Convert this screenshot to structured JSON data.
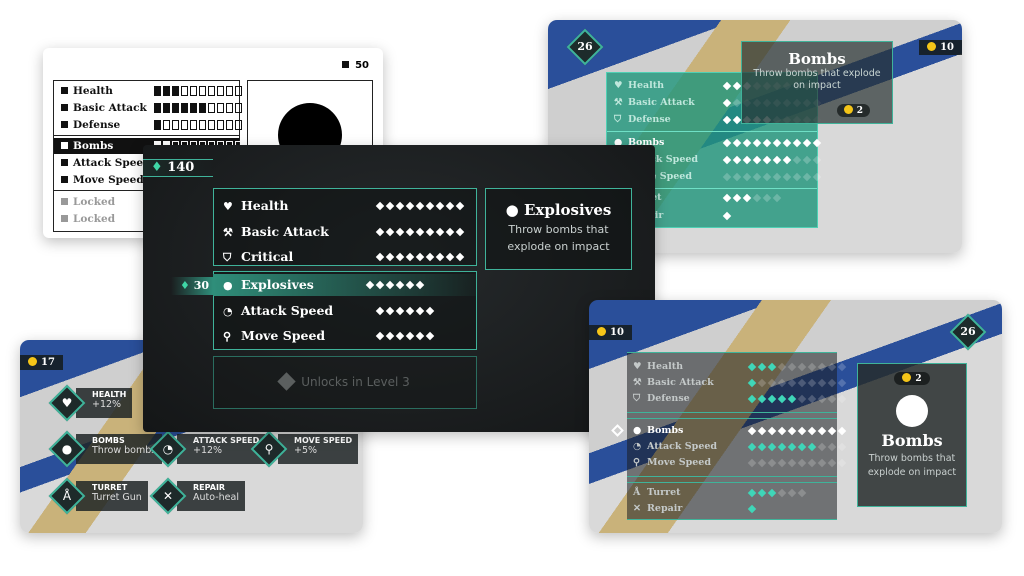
{
  "colors": {
    "accent": "#3fb39a",
    "pip_active": "#3fd6b8",
    "coin": "#f5c518",
    "gem": "#3fd6a6"
  },
  "wireframe": {
    "coins": "50",
    "stats": [
      {
        "label": "Health",
        "filled": 3,
        "total": 10
      },
      {
        "label": "Basic Attack",
        "filled": 6,
        "total": 10
      },
      {
        "label": "Defense",
        "filled": 1,
        "total": 10
      }
    ],
    "abilities": [
      {
        "label": "Bombs",
        "filled": 2,
        "total": 10,
        "selected": true
      },
      {
        "label": "Attack Speed"
      },
      {
        "label": "Move Speed"
      }
    ],
    "locked": [
      "Locked",
      "Locked"
    ]
  },
  "center": {
    "gems": "140",
    "stats": [
      {
        "label": "Health",
        "icon": "heart-icon",
        "filled": 9,
        "total": 9
      },
      {
        "label": "Basic Attack",
        "icon": "wrench-icon",
        "filled": 9,
        "total": 9
      },
      {
        "label": "Critical",
        "icon": "shield-icon",
        "filled": 9,
        "total": 9
      }
    ],
    "abilities": [
      {
        "label": "Explosives",
        "icon": "bomb-icon",
        "filled": 6,
        "total": 6
      },
      {
        "label": "Attack Speed",
        "icon": "speedometer-icon",
        "filled": 6,
        "total": 6
      },
      {
        "label": "Move Speed",
        "icon": "running-icon",
        "filled": 6,
        "total": 6
      }
    ],
    "ability_cost": "30",
    "locked_text": "Unlocks in Level 3",
    "detail": {
      "title": "Explosives",
      "desc": "Throw bombs that explode on impact"
    }
  },
  "top_right": {
    "level": "26",
    "coins": "10",
    "rows": [
      {
        "label": "Health",
        "icon": "heart-icon",
        "filled": 2,
        "half": 1,
        "total": 10
      },
      {
        "label": "Basic Attack",
        "icon": "wrench-icon",
        "filled": 1,
        "half": 0,
        "total": 10
      },
      {
        "label": "Defense",
        "icon": "shield-icon",
        "filled": 2,
        "half": 3,
        "total": 10
      },
      {
        "label": "Bombs",
        "icon": "bomb-icon",
        "filled": 10,
        "half": 0,
        "total": 10
      },
      {
        "label": "Attack Speed",
        "icon": "speedometer-icon",
        "filled": 7,
        "half": 0,
        "total": 10
      },
      {
        "label": "Move Speed",
        "icon": "running-icon",
        "filled": 0,
        "half": 0,
        "total": 10
      },
      {
        "label": "Turret",
        "icon": "turret-icon",
        "filled": 3,
        "half": 0,
        "total": 6
      },
      {
        "label": "Repair",
        "icon": "repair-icon",
        "filled": 1,
        "half": 0,
        "total": 1
      }
    ],
    "tooltip": {
      "title": "Bombs",
      "desc": "Throw bombs that explode on impact",
      "cost": "2"
    }
  },
  "bottom_right": {
    "level": "26",
    "coins": "10",
    "rows": [
      {
        "label": "Health",
        "icon": "heart-icon",
        "filled": 3,
        "total": 10
      },
      {
        "label": "Basic Attack",
        "icon": "wrench-icon",
        "filled": 1,
        "total": 10
      },
      {
        "label": "Defense",
        "icon": "shield-icon",
        "filled": 5,
        "total": 10
      },
      {
        "label": "Bombs",
        "icon": "bomb-icon",
        "filled": 10,
        "total": 10,
        "selected": true
      },
      {
        "label": "Attack Speed",
        "icon": "speedometer-icon",
        "filled": 7,
        "total": 10
      },
      {
        "label": "Move Speed",
        "icon": "running-icon",
        "filled": 0,
        "total": 10
      },
      {
        "label": "Turret",
        "icon": "turret-icon",
        "filled": 3,
        "total": 6
      },
      {
        "label": "Repair",
        "icon": "repair-icon",
        "filled": 1,
        "total": 1
      }
    ],
    "detail": {
      "cost": "2",
      "title": "Bombs",
      "desc": "Throw bombs that explode on impact"
    }
  },
  "bottom_left": {
    "coins": "17",
    "nodes": [
      {
        "title": "HEALTH",
        "value": "+12%",
        "icon": "heart-icon"
      },
      {
        "title": "BOMBS",
        "value": "Throw bombs",
        "icon": "bomb-icon"
      },
      {
        "title": "ATTACK SPEED",
        "value": "+12%",
        "icon": "speedometer-icon"
      },
      {
        "title": "MOVE SPEED",
        "value": "+5%",
        "icon": "running-icon"
      },
      {
        "title": "TURRET",
        "value": "Turret Gun",
        "icon": "turret-icon"
      },
      {
        "title": "REPAIR",
        "value": "Auto-heal",
        "icon": "repair-icon"
      }
    ]
  }
}
